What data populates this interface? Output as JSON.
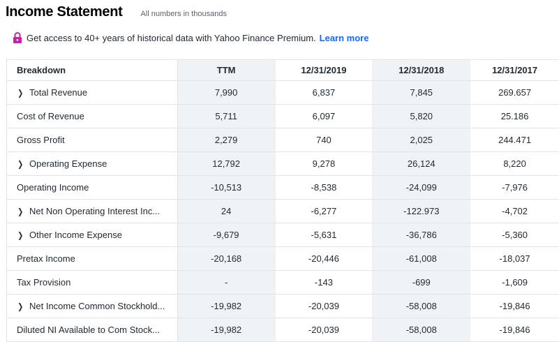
{
  "header": {
    "title": "Income Statement",
    "subtitle": "All numbers in thousands"
  },
  "promo": {
    "text": "Get access to 40+ years of historical data with Yahoo Finance Premium.",
    "link": "Learn more",
    "icon": "lock-icon",
    "icon_color": "#c51fac"
  },
  "table": {
    "columns": [
      "Breakdown",
      "TTM",
      "12/31/2019",
      "12/31/2018",
      "12/31/2017"
    ],
    "rows": [
      {
        "label": "Total Revenue",
        "expandable": true,
        "values": [
          "7,990",
          "6,837",
          "7,845",
          "269.657"
        ]
      },
      {
        "label": "Cost of Revenue",
        "expandable": false,
        "values": [
          "5,711",
          "6,097",
          "5,820",
          "25.186"
        ]
      },
      {
        "label": "Gross Profit",
        "expandable": false,
        "values": [
          "2,279",
          "740",
          "2,025",
          "244.471"
        ]
      },
      {
        "label": "Operating Expense",
        "expandable": true,
        "values": [
          "12,792",
          "9,278",
          "26,124",
          "8,220"
        ]
      },
      {
        "label": "Operating Income",
        "expandable": false,
        "values": [
          "-10,513",
          "-8,538",
          "-24,099",
          "-7,976"
        ]
      },
      {
        "label": "Net Non Operating Interest Inc...",
        "expandable": true,
        "values": [
          "24",
          "-6,277",
          "-122.973",
          "-4,702"
        ]
      },
      {
        "label": "Other Income Expense",
        "expandable": true,
        "values": [
          "-9,679",
          "-5,631",
          "-36,786",
          "-5,360"
        ]
      },
      {
        "label": "Pretax Income",
        "expandable": false,
        "values": [
          "-20,168",
          "-20,446",
          "-61,008",
          "-18,037"
        ]
      },
      {
        "label": "Tax Provision",
        "expandable": false,
        "values": [
          "-",
          "-143",
          "-699",
          "-1,609"
        ]
      },
      {
        "label": "Net Income Common Stockhold...",
        "expandable": true,
        "values": [
          "-19,982",
          "-20,039",
          "-58,008",
          "-19,846"
        ]
      },
      {
        "label": "Diluted NI Available to Com Stock...",
        "expandable": false,
        "values": [
          "-19,982",
          "-20,039",
          "-58,008",
          "-19,846"
        ]
      }
    ]
  }
}
